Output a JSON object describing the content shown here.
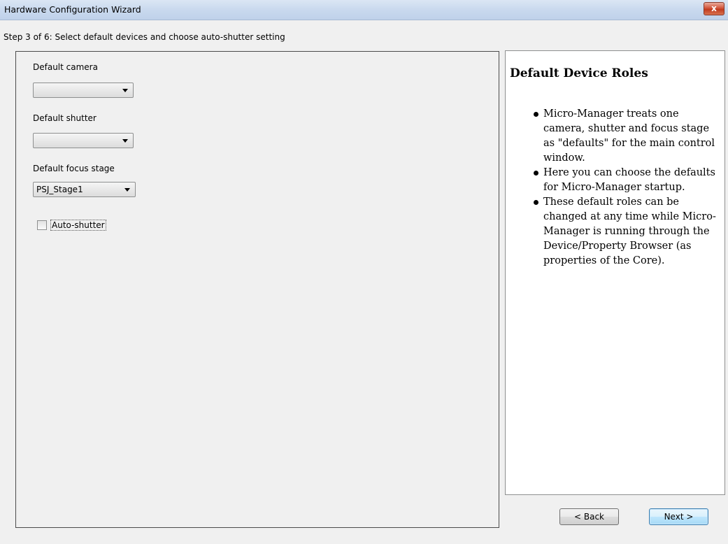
{
  "window": {
    "title": "Hardware Configuration Wizard",
    "close_label": "x"
  },
  "step_label": "Step 3 of 6: Select default devices and choose auto-shutter setting",
  "fields": {
    "camera": {
      "label": "Default camera",
      "value": ""
    },
    "shutter": {
      "label": "Default shutter",
      "value": ""
    },
    "focus": {
      "label": "Default focus stage",
      "value": "PSJ_Stage1"
    }
  },
  "auto_shutter": {
    "label": "Auto-shutter",
    "checked": false
  },
  "help": {
    "title": "Default Device Roles",
    "items": [
      "Micro-Manager treats one camera, shutter and focus stage as \"defaults\" for the main control window.",
      "Here you can choose the defaults for Micro-Manager startup.",
      "These default roles can be changed at any time while Micro-Manager is running through the Device/Property Browser (as properties of the Core)."
    ]
  },
  "buttons": {
    "back": "< Back",
    "next": "Next >"
  }
}
